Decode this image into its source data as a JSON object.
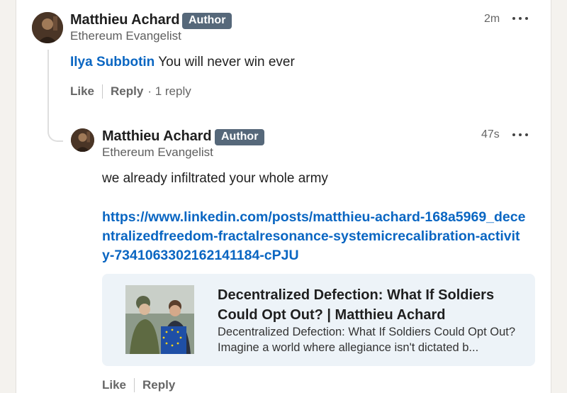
{
  "comment": {
    "author_name": "Matthieu Achard",
    "badge": "Author",
    "subtitle": "Ethereum Evangelist",
    "time": "2m",
    "mention": "Ilya Subbotin",
    "text": " You will never win ever",
    "actions": {
      "like": "Like",
      "reply": "Reply",
      "reply_count": "· 1 reply"
    }
  },
  "reply": {
    "author_name": "Matthieu Achard",
    "badge": "Author",
    "subtitle": "Ethereum Evangelist",
    "time": "47s",
    "text": "we already infiltrated your whole army",
    "link": "https://www.linkedin.com/posts/matthieu-achard-168a5969_decentralizedfreedom-fractalresonance-systemicrecalibration-activity-7341063302162141184-cPJU",
    "preview": {
      "title": "Decentralized Defection: What If Soldiers Could Opt Out? | Matthieu Achard",
      "description": "Decentralized Defection: What If Soldiers Could Opt Out? Imagine a world where allegiance isn't dictated b..."
    },
    "actions": {
      "like": "Like",
      "reply": "Reply"
    }
  },
  "icons": {
    "avatar": "profile-photo",
    "more": "more-options-icon"
  },
  "colors": {
    "badge": "#56687a",
    "link": "#0a66c2",
    "preview_bg": "#edf3f8"
  }
}
